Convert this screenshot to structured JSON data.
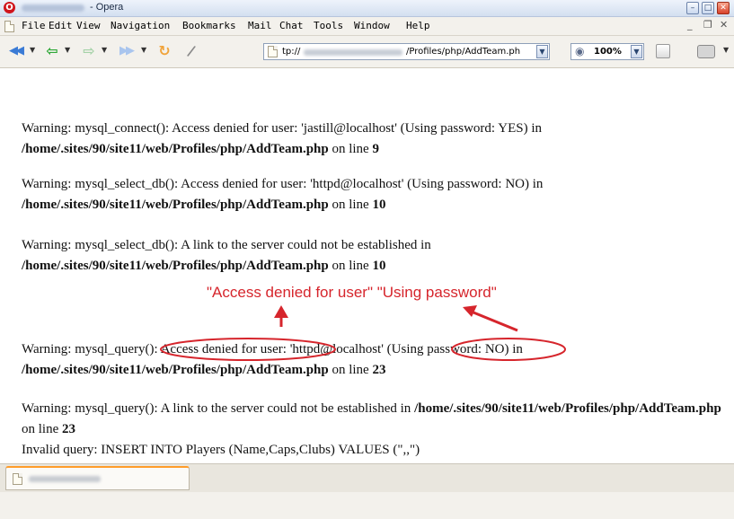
{
  "window": {
    "title": "- Opera",
    "buttons": {
      "minimize": "–",
      "maximize": "□",
      "close": "✕"
    }
  },
  "menu": {
    "items": [
      "File",
      "Edit",
      "View",
      "Navigation",
      "Bookmarks",
      "Mail",
      "Chat",
      "Tools",
      "Window",
      "Help"
    ],
    "doc_minimize": "_",
    "doc_restore": "❐",
    "doc_close": "✕"
  },
  "toolbar": {
    "back_icon": "◀◀",
    "rewind_icon": "⇦",
    "forward_icon": "⇨",
    "fastforward_icon": "▶▶",
    "reload_icon": "↻",
    "wand_icon": "/",
    "address_prefix": "tp://",
    "address_suffix": "/Profiles/php/AddTeam.ph",
    "zoom": "100%"
  },
  "content": {
    "warnings": [
      {
        "label": "Warning",
        "text": ": mysql_connect(): Access denied for user: 'jastill@localhost' (Using password: YES) in ",
        "path": "/home/.sites/90/site11/web/Profiles/php/AddTeam.php",
        "line_text": " on line ",
        "line": "9"
      },
      {
        "label": "Warning",
        "text": ": mysql_select_db(): Access denied for user: 'httpd@localhost' (Using password: NO) in ",
        "path": "/home/.sites/90/site11/web/Profiles/php/AddTeam.php",
        "line_text": " on line ",
        "line": "10"
      },
      {
        "label": "Warning",
        "text": ": mysql_select_db(): A link to the server could not be established in ",
        "path": "/home/.sites/90/site11/web/Profiles/php/AddTeam.php",
        "line_text": " on line ",
        "line": "10"
      },
      {
        "label": "Warning",
        "text": ": mysql_query(): Access denied for user: 'httpd@localhost' (Using password: NO) in ",
        "path": "/home/.sites/90/site11/web/Profiles/php/AddTeam.php",
        "line_text": " on line ",
        "line": "23"
      },
      {
        "label": "Warning",
        "text": ": mysql_query(): A link to the server could not be established in ",
        "path": "/home/.sites/90/site11/web/Profiles/php/AddTeam.php",
        "line_text": " on line ",
        "line": "23"
      }
    ],
    "invalid_query": "Invalid query: INSERT INTO Players (Name,Caps,Clubs) VALUES (\",,\")",
    "annotation": "\"Access denied for user\" \"Using password\""
  },
  "colors": {
    "annotation": "#d6252c",
    "tab_accent": "#ff9c2a",
    "chrome": "#f3f1ec"
  }
}
